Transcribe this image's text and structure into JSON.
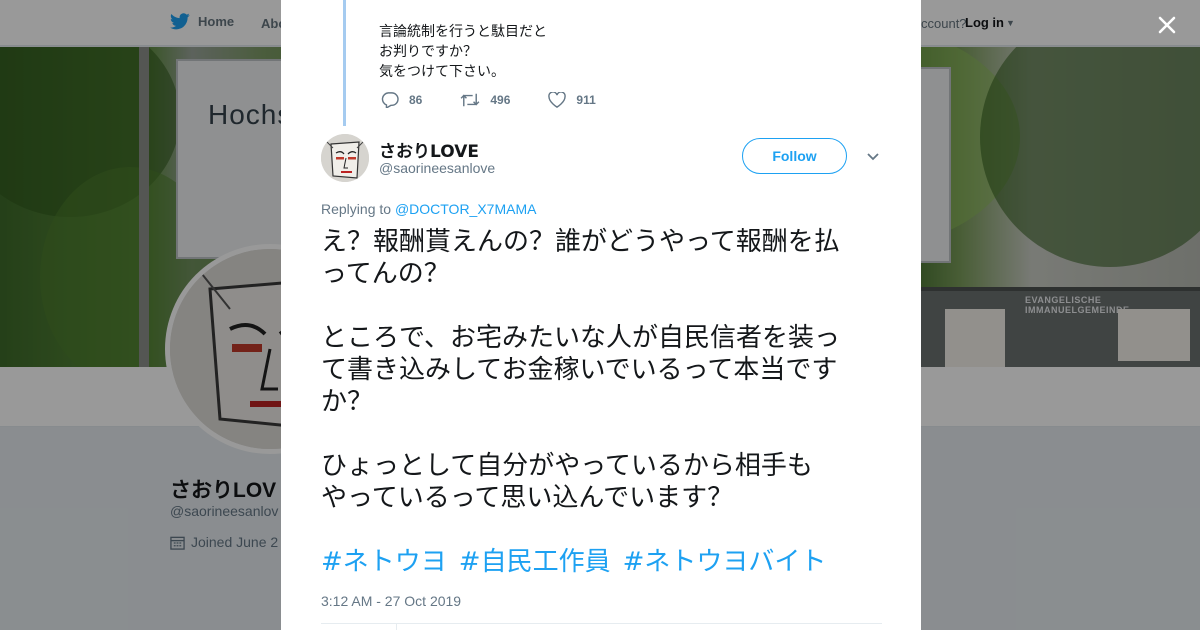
{
  "topbar": {
    "home_label": "Home",
    "about_label": "Abo",
    "account_prompt": "ccount?",
    "login_label": "Log in"
  },
  "banner": {
    "sign_text": "Hochs",
    "board_text": "EVANGELISCHE IMMANUELGEMEINDE"
  },
  "profile": {
    "name": "さおりLOV",
    "handle": "@saorineesanlov",
    "joined": "Joined June 2"
  },
  "parent_tweet": {
    "lines": [
      "言論統制を行うと駄目だと",
      "お判りですか？",
      "気をつけて下さい。"
    ],
    "replies": "86",
    "retweets": "496",
    "likes": "911"
  },
  "tweet": {
    "author_name": "さおりLOVE",
    "author_handle": "@saorineesanlove",
    "follow_label": "Follow",
    "replying_prefix": "Replying to",
    "replying_to": "@DOCTOR_X7MAMA",
    "lines": [
      "え？報酬貰えんの？誰がどうやって報酬を払",
      "ってんの？",
      "ところで、お宅みたいな人が自民信者を装っ",
      "て書き込みしてお金稼いでいるって本当です",
      "か？",
      "ひょっとして自分がやっているから相手も",
      "やっているって思い込んでいます？"
    ],
    "hashtags": [
      "#ネトウヨ",
      "#自民工作員",
      "#ネトウヨバイト"
    ],
    "timestamp": "3:12 AM - 27 Oct 2019"
  },
  "colors": {
    "accent": "#1da1f2",
    "text": "#14171a",
    "muted": "#657786",
    "thread_line": "#a5cbf0"
  },
  "icons": [
    "twitter-bird-icon",
    "calendar-icon",
    "reply-icon",
    "retweet-icon",
    "like-icon",
    "chevron-down-icon",
    "close-icon"
  ]
}
